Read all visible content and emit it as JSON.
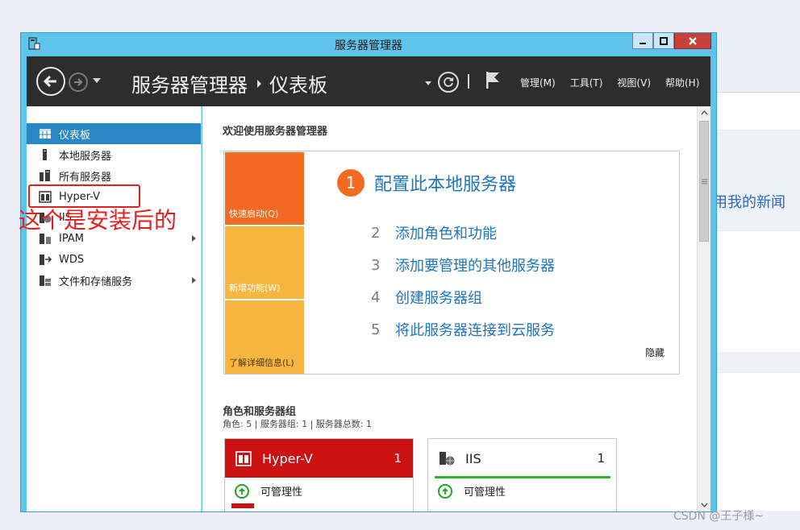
{
  "window": {
    "title": "服务器管理器"
  },
  "background_page": {
    "snippet": "用我的新闻"
  },
  "header": {
    "crumb_root": "服务器管理器",
    "crumb_page": "仪表板",
    "menus": [
      "管理(M)",
      "工具(T)",
      "视图(V)",
      "帮助(H)"
    ]
  },
  "sidebar": {
    "items": [
      {
        "label": "仪表板",
        "icon": "dashboard-icon",
        "active": true
      },
      {
        "label": "本地服务器",
        "icon": "server-icon"
      },
      {
        "label": "所有服务器",
        "icon": "servers-icon"
      },
      {
        "label": "Hyper-V",
        "icon": "hyperv-icon"
      },
      {
        "label": "IIS",
        "icon": "iis-icon"
      },
      {
        "label": "IPAM",
        "icon": "ipam-icon",
        "expandable": true
      },
      {
        "label": "WDS",
        "icon": "wds-icon"
      },
      {
        "label": "文件和存储服务",
        "icon": "storage-icon",
        "expandable": true
      }
    ]
  },
  "annotation": {
    "text": "这个是安装后的",
    "color": "#e62020"
  },
  "main": {
    "welcome": "欢迎使用服务器管理器",
    "quick_start": {
      "tiles": [
        "快速启动(Q)",
        "新增功能(W)",
        "了解详细信息(L)"
      ],
      "step1": {
        "num": "1",
        "label": "配置此本地服务器"
      },
      "steps": [
        {
          "num": "2",
          "label": "添加角色和功能"
        },
        {
          "num": "3",
          "label": "添加要管理的其他服务器"
        },
        {
          "num": "4",
          "label": "创建服务器组"
        },
        {
          "num": "5",
          "label": "将此服务器连接到云服务"
        }
      ],
      "hide": "隐藏"
    },
    "roles": {
      "title": "角色和服务器组",
      "summary": "角色: 5 | 服务器组: 1 | 服务器总数: 1",
      "cards": [
        {
          "name": "Hyper-V",
          "count": "1",
          "status": "可管理性",
          "accent": "#cc1111"
        },
        {
          "name": "IIS",
          "count": "1",
          "status": "可管理性",
          "accent": "#2ab52a"
        }
      ]
    }
  },
  "watermark": "CSDN @王子様~"
}
